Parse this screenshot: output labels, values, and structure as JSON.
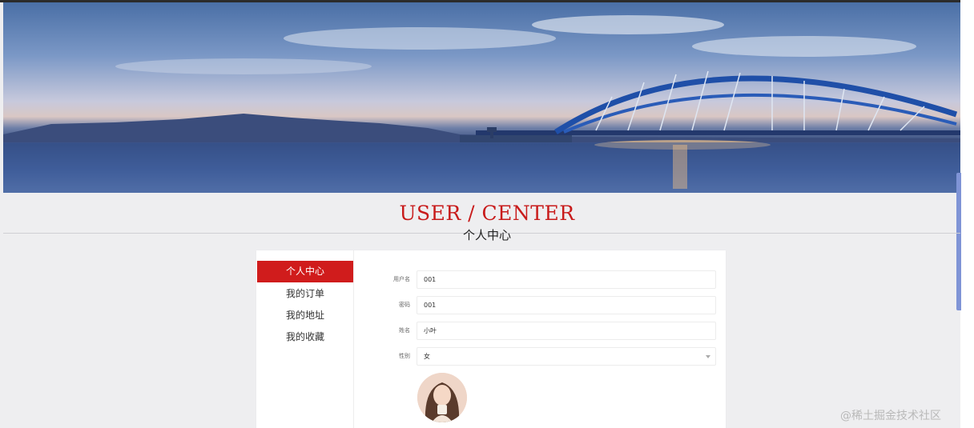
{
  "header": {
    "title_en": "USER / CENTER",
    "title_cn": "个人中心"
  },
  "sidebar": {
    "items": [
      {
        "label": "个人中心",
        "active": true
      },
      {
        "label": "我的订单",
        "active": false
      },
      {
        "label": "我的地址",
        "active": false
      },
      {
        "label": "我的收藏",
        "active": false
      }
    ]
  },
  "form": {
    "fields": [
      {
        "label": "用户名",
        "value": "001"
      },
      {
        "label": "密码",
        "value": "001"
      },
      {
        "label": "姓名",
        "value": "小叶"
      },
      {
        "label": "性别",
        "value": "女"
      }
    ]
  },
  "watermark": "@稀土掘金技术社区",
  "colors": {
    "accent": "#d01c1c",
    "title": "#c81b1b",
    "page_bg": "#eeeef0",
    "panel_bg": "#ffffff"
  },
  "icons": {
    "select_caret": "chevron-down-icon",
    "avatar": "user-avatar"
  }
}
